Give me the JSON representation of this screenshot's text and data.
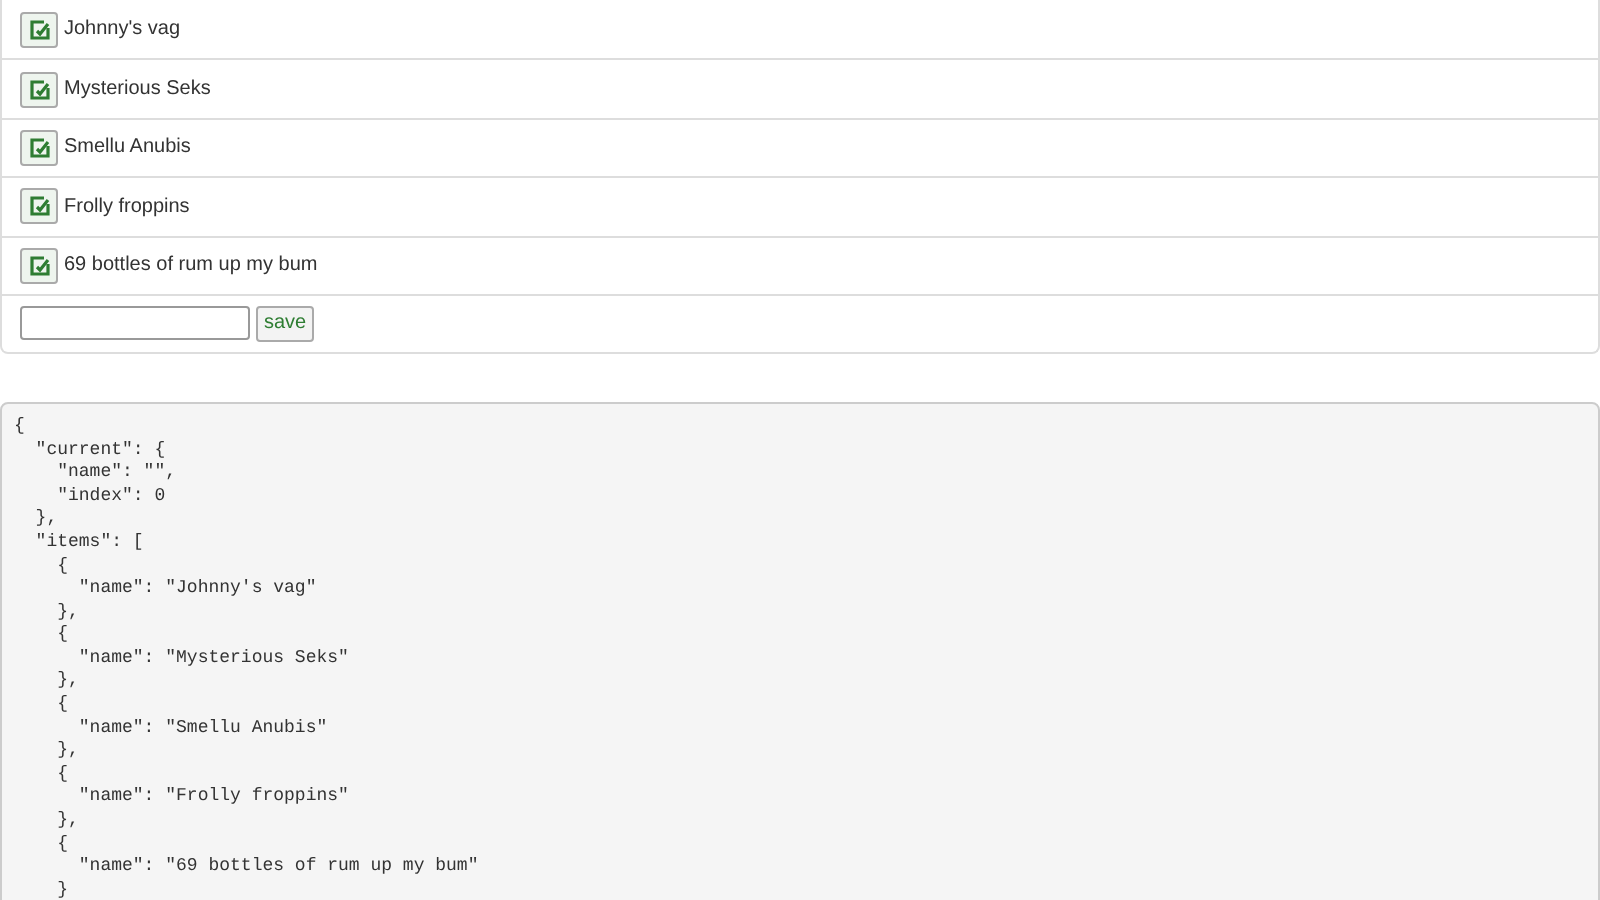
{
  "items": [
    {
      "name": "Johnny's vag"
    },
    {
      "name": "Mysterious Seks"
    },
    {
      "name": "Smellu Anubis"
    },
    {
      "name": "Frolly froppins"
    },
    {
      "name": "69 bottles of rum up my bum"
    }
  ],
  "new_item": {
    "save_label": "save"
  },
  "code_lines": [
    "{",
    "  \"current\": {",
    "    \"name\": \"\",",
    "    \"index\": 0",
    "  },",
    "  \"items\": [",
    "    {",
    "      \"name\": \"Johnny's vag\"",
    "    },",
    "    {",
    "      \"name\": \"Mysterious Seks\"",
    "    },",
    "    {",
    "      \"name\": \"Smellu Anubis\"",
    "    },",
    "    {",
    "      \"name\": \"Frolly froppins\"",
    "    },",
    "    {",
    "      \"name\": \"69 bottles of rum up my bum\"",
    "    }"
  ]
}
